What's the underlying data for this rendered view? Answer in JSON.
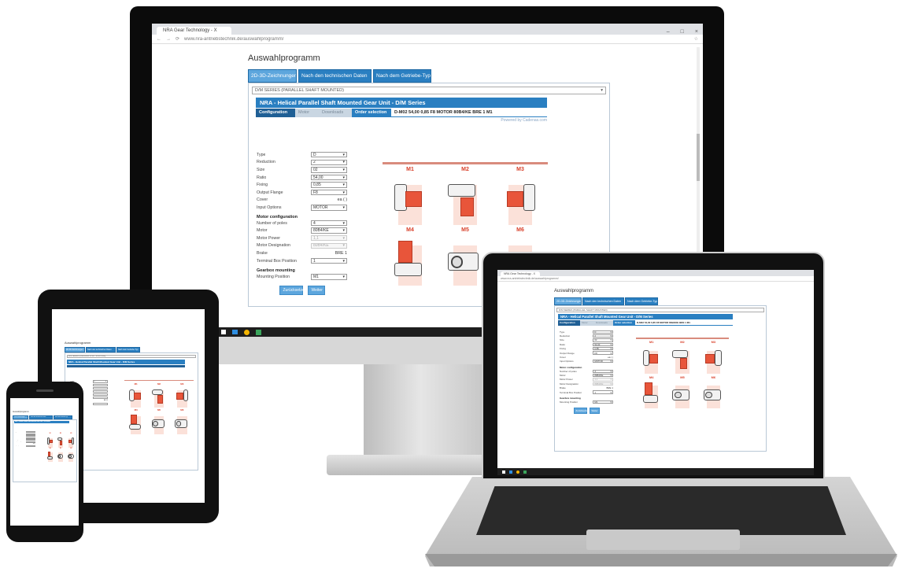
{
  "browser": {
    "tab_title": "NRA Gear Technology - X",
    "url": "www.nra-antriebstechnik.de/auswahlprogramm/",
    "window_controls": [
      "–",
      "□",
      "×"
    ]
  },
  "page": {
    "title": "Auswahlprogramm",
    "tabs": [
      {
        "label": "2D-3D-Zeichnungen",
        "active": true
      },
      {
        "label": "Nach den technischen Daten",
        "active": false
      },
      {
        "label": "Nach dem Getriebe-Typ",
        "active": false
      }
    ],
    "series_select": "D/M SERIES (PARALLEL SHAFT MOUNTED)",
    "product_header": "NRA - Helical Parallel Shaft Mounted Gear Unit - D/M Series",
    "subtabs": {
      "configuration": "Configuration",
      "motor": "Motor",
      "downloads": "Downloads",
      "order_selection_label": "Order selection",
      "order_code": "D-M02 54,00 0,85 F8 MOTOR 80B4/KE BRE 1 M1"
    },
    "powered_by": "Powered by Cadenas.com"
  },
  "form": {
    "rows": [
      {
        "label": "Type",
        "value": "D",
        "kind": "select"
      },
      {
        "label": "Reduction",
        "value": "2",
        "kind": "select"
      },
      {
        "label": "Size",
        "value": "02",
        "kind": "select"
      },
      {
        "label": "Ratio",
        "value": "54,00",
        "kind": "select"
      },
      {
        "label": "Fixing",
        "value": "0,85",
        "kind": "select"
      },
      {
        "label": "Output Flange",
        "value": "F8",
        "kind": "select"
      },
      {
        "label": "Cover",
        "value": "ea ( )",
        "kind": "text"
      },
      {
        "label": "Input Options",
        "value": "MOTOR",
        "kind": "select"
      }
    ],
    "motor_section": "Motor configuration",
    "motor_rows": [
      {
        "label": "Number of poles",
        "value": "4",
        "kind": "select"
      },
      {
        "label": "Motor",
        "value": "80B4/KE",
        "kind": "select"
      },
      {
        "label": "Motor Power",
        "value": "1,1",
        "kind": "disabled"
      },
      {
        "label": "Motor Designation",
        "value": "80B4/KE",
        "kind": "disabled"
      },
      {
        "label": "Brake",
        "value": "BRE 1",
        "kind": "text"
      },
      {
        "label": "Terminal Box Position",
        "value": "1",
        "kind": "select"
      }
    ],
    "gearbox_section": "Gearbox mounting",
    "gearbox_rows": [
      {
        "label": "Mounting Position",
        "value": "M1",
        "kind": "select"
      }
    ],
    "buttons": {
      "reset": "Zurücksetzen",
      "next": "Weiter"
    }
  },
  "mounting_positions": [
    "M1",
    "M2",
    "M3",
    "M4",
    "M5",
    "M6"
  ],
  "colors": {
    "accent": "#2a7fc1",
    "accent_light": "#5da6dd",
    "mount_orange": "#e8553a",
    "mount_label": "#d9402a"
  }
}
